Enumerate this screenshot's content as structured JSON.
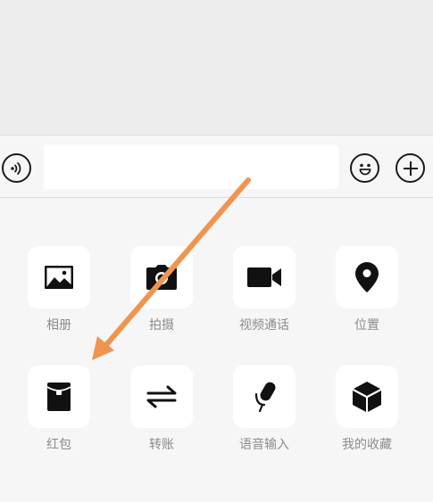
{
  "input_bar": {
    "voice_icon": "voice-waves-icon",
    "text_value": "",
    "emoji_icon": "smiley-icon",
    "plus_icon": "plus-icon"
  },
  "panel": {
    "items": [
      {
        "label": "相册",
        "icon": "image-icon"
      },
      {
        "label": "拍摄",
        "icon": "camera-icon"
      },
      {
        "label": "视频通话",
        "icon": "video-camera-icon"
      },
      {
        "label": "位置",
        "icon": "location-pin-icon"
      },
      {
        "label": "红包",
        "icon": "red-packet-icon"
      },
      {
        "label": "转账",
        "icon": "transfer-arrows-icon"
      },
      {
        "label": "语音输入",
        "icon": "microphone-icon"
      },
      {
        "label": "我的收藏",
        "icon": "cube-icon"
      }
    ]
  },
  "annotation": {
    "arrow_color": "#ef9550"
  }
}
